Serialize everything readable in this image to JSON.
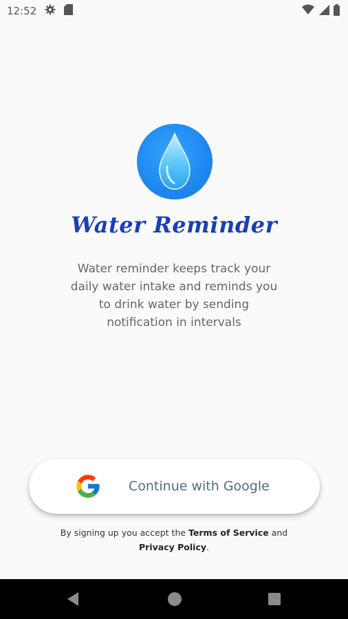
{
  "status_bar": {
    "time": "12:52",
    "left_icons": [
      "settings-icon",
      "sd-card-icon"
    ],
    "right_icons": [
      "wifi-icon",
      "signal-icon",
      "battery-icon"
    ]
  },
  "app": {
    "logo_icon": "water-drop-icon",
    "title": "Water Reminder",
    "description": "Water reminder keeps track your daily water intake and reminds you to drink water by sending notification in intervals"
  },
  "auth": {
    "google_button_label": "Continue with Google",
    "google_icon": "google-g-icon"
  },
  "legal": {
    "prefix": "By signing up you accept the ",
    "terms_link": "Terms of Service",
    "and": " and",
    "privacy_link": "Privacy Policy",
    "suffix": "."
  },
  "nav_bar": {
    "buttons": [
      "back-icon",
      "home-icon",
      "recents-icon"
    ]
  },
  "colors": {
    "title": "#1a3fb5",
    "logo_blue": "#1e88f0",
    "google_label": "#4a6d88",
    "background": "#fafafa"
  }
}
